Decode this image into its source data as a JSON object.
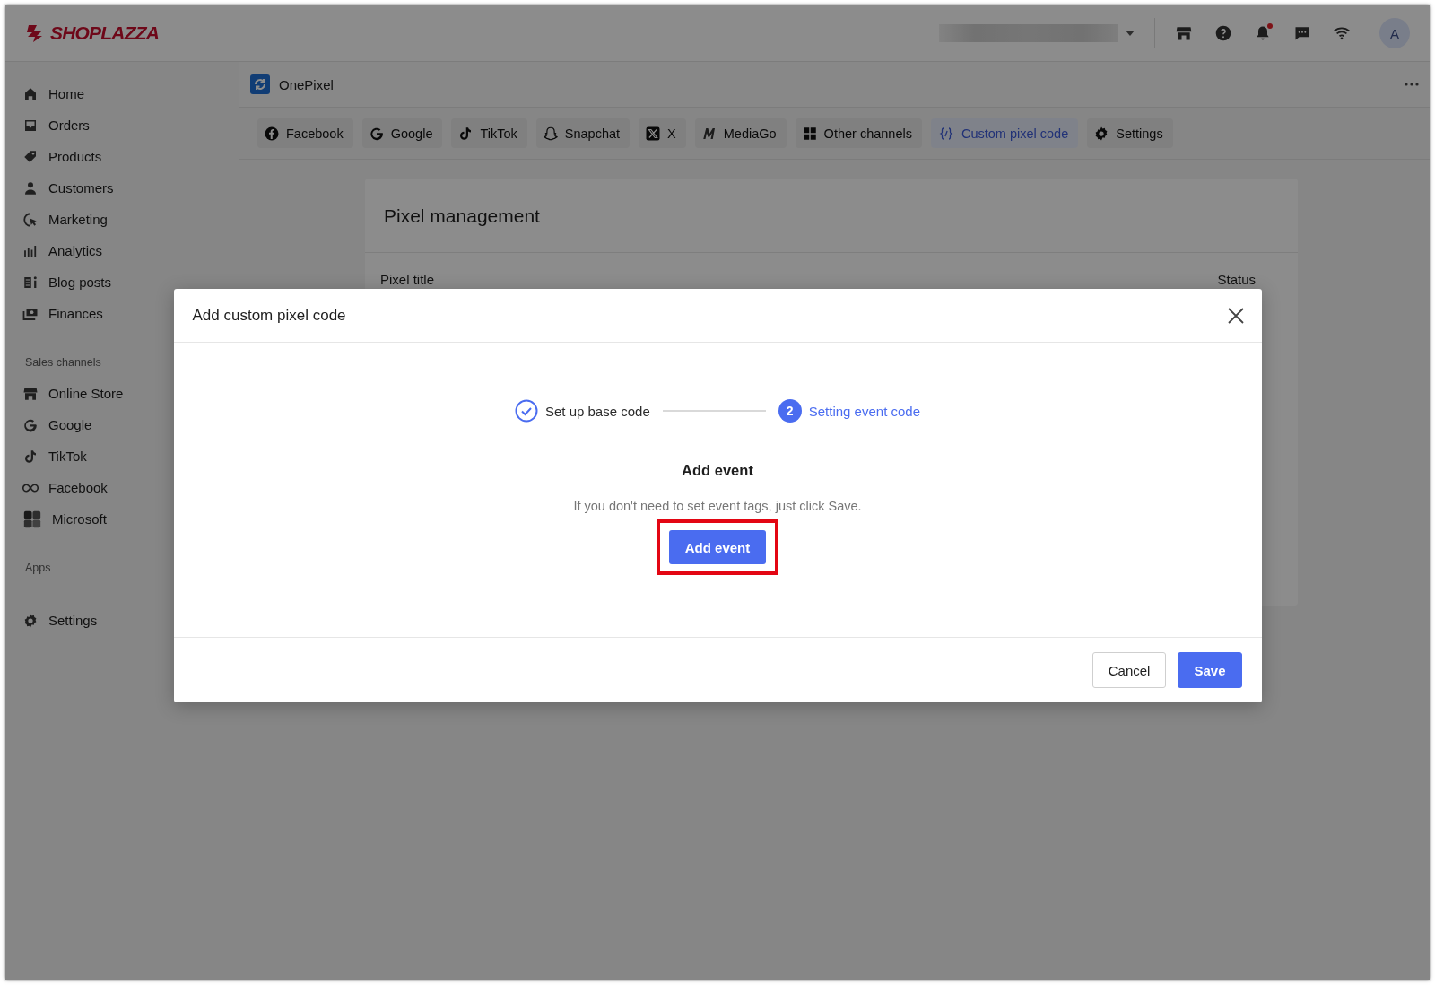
{
  "topbar": {
    "logo": "SHOPLAZZA",
    "avatar": "A",
    "notification_dot": true
  },
  "sidebar": {
    "items": [
      {
        "label": "Home"
      },
      {
        "label": "Orders"
      },
      {
        "label": "Products"
      },
      {
        "label": "Customers"
      },
      {
        "label": "Marketing"
      },
      {
        "label": "Analytics"
      },
      {
        "label": "Blog posts"
      },
      {
        "label": "Finances"
      }
    ],
    "sales_channels": {
      "heading": "Sales channels",
      "items": [
        {
          "label": "Online Store"
        },
        {
          "label": "Google"
        },
        {
          "label": "TikTok"
        },
        {
          "label": "Facebook"
        },
        {
          "label": "Microsoft"
        }
      ]
    },
    "apps": {
      "heading": "Apps"
    },
    "settings": {
      "label": "Settings"
    }
  },
  "app_header": {
    "title": "OnePixel"
  },
  "tabs": [
    {
      "label": "Facebook",
      "selected": false
    },
    {
      "label": "Google",
      "selected": false
    },
    {
      "label": "TikTok",
      "selected": false
    },
    {
      "label": "Snapchat",
      "selected": false
    },
    {
      "label": "X",
      "selected": false
    },
    {
      "label": "MediaGo",
      "selected": false
    },
    {
      "label": "Other channels",
      "selected": false
    },
    {
      "label": "Custom pixel code",
      "selected": true
    },
    {
      "label": "Settings",
      "selected": false
    }
  ],
  "card": {
    "title": "Pixel management",
    "columns": [
      "Pixel title",
      "Status"
    ]
  },
  "modal": {
    "title": "Add custom pixel code",
    "steps": [
      {
        "label": "Set up base code",
        "kind": "done"
      },
      {
        "label": "Setting event code",
        "kind": "current",
        "number": "2"
      }
    ],
    "heading": "Add event",
    "hint": "If you don't need to set event tags, just click Save.",
    "action": {
      "label": "Add event",
      "highlighted": true
    },
    "buttons": [
      {
        "label": "Cancel",
        "kind": "secondary"
      },
      {
        "label": "Save",
        "kind": "primary"
      }
    ]
  }
}
